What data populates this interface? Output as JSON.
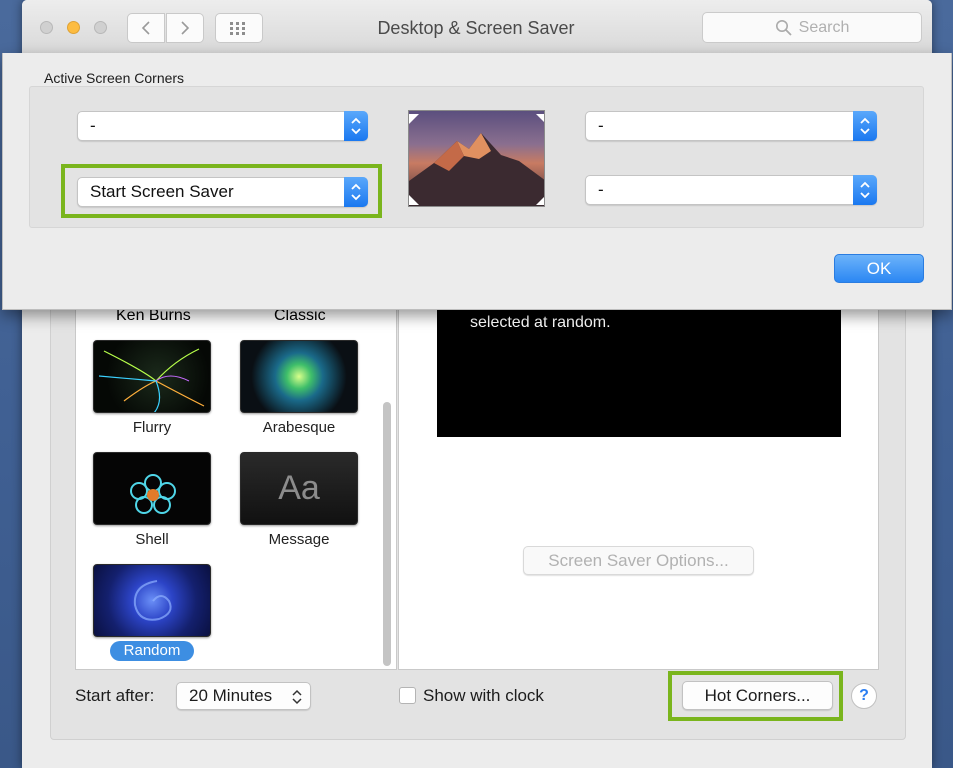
{
  "window": {
    "title": "Desktop & Screen Saver",
    "search_placeholder": "Search",
    "traffic_lights": {
      "close": "#fc605c",
      "minimize": "#fdbc40",
      "zoom": "#cfcfcf"
    }
  },
  "sheet": {
    "section_title": "Active Screen Corners",
    "corners": {
      "top_left": "-",
      "bottom_left": "Start Screen Saver",
      "top_right": "-",
      "bottom_right": "-"
    },
    "ok_label": "OK"
  },
  "savers": {
    "top_row_labels": [
      "Ken Burns",
      "Classic"
    ],
    "items": [
      {
        "label": "Flurry"
      },
      {
        "label": "Arabesque"
      },
      {
        "label": "Shell"
      },
      {
        "label": "Message",
        "thumb_text": "Aa"
      },
      {
        "label": "Random",
        "selected": true
      }
    ]
  },
  "preview": {
    "text": "selected at random.",
    "options_button": "Screen Saver Options..."
  },
  "footer": {
    "start_after_label": "Start after:",
    "start_after_value": "20 Minutes",
    "show_clock_label": "Show with clock",
    "show_clock_checked": false,
    "hot_corners_label": "Hot Corners...",
    "help_label": "?"
  },
  "colors": {
    "accent_blue": "#1a78f0",
    "highlight_green": "#7ab51d",
    "selection_blue": "#3d8ee2"
  }
}
